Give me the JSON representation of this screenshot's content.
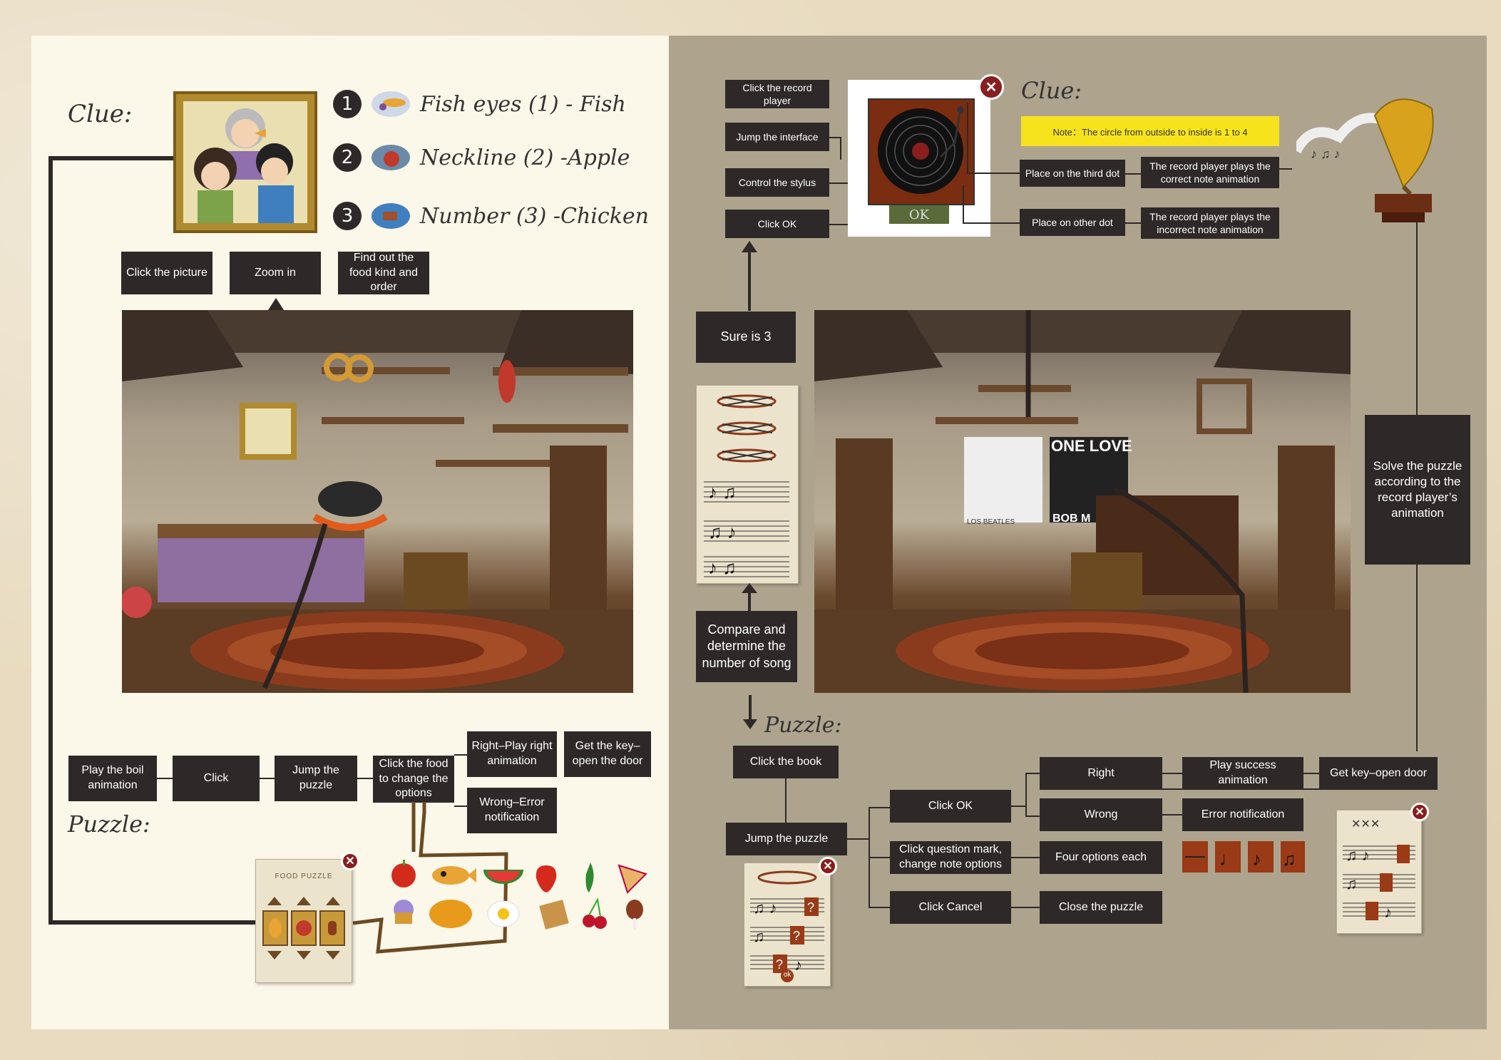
{
  "left": {
    "clue_heading": "Clue:",
    "clue_items": [
      {
        "num": "1",
        "text": "Fish eyes (1) - Fish"
      },
      {
        "num": "2",
        "text": "Neckline (2) -Apple"
      },
      {
        "num": "3",
        "text": "Number (3) -Chicken"
      }
    ],
    "top_flow": [
      "Click the picture",
      "Zoom in",
      "Find out the food kind and order"
    ],
    "bottom_flow": {
      "play_boil": "Play the boil animation",
      "click": "Click",
      "jump_puzzle": "Jump the puzzle",
      "click_food": "Click the food to change the options",
      "right": "Right–Play right animation",
      "get_key": "Get the key–open the door",
      "wrong": "Wrong–Error notification"
    },
    "puzzle_heading": "Puzzle:",
    "puzzle_card_title": "FOOD PUZZLE",
    "food_icons": [
      "apple-icon",
      "fish-icon",
      "watermelon-icon",
      "strawberry-icon",
      "pepper-icon",
      "pizza-icon",
      "muffin-icon",
      "pumpkin-icon",
      "egg-icon",
      "bread-icon",
      "cherry-icon",
      "drumstick-icon"
    ]
  },
  "right": {
    "top_flow": [
      "Click the record player",
      "Jump the interface",
      "Control the stylus",
      "Click OK"
    ],
    "ok_label": "OK",
    "clue_heading": "Clue:",
    "note": "Note：The circle from outside to inside is 1 to 4",
    "dot_actions": [
      "Place on the third dot",
      "Place on other dot"
    ],
    "dot_results": [
      "The record player plays the correct note animation",
      "The record player plays the incorrect note animation"
    ],
    "sure": "Sure is 3",
    "compare": "Compare and determine the number of song",
    "solve": "Solve the puzzle according to the record player’s animation",
    "puzzle_heading": "Puzzle:",
    "poster_text": [
      "ONE LOVE",
      "BOB M",
      "LOS BEATLES"
    ],
    "bottom_flow": {
      "click_book": "Click the book",
      "jump_puzzle": "Jump the puzzle",
      "click_ok": "Click OK",
      "click_q": "Click question mark, change note options",
      "click_cancel": "Click Cancel",
      "right": "Right",
      "wrong": "Wrong",
      "four_options": "Four options each",
      "close": "Close the puzzle",
      "play_success": "Play success animation",
      "error": "Error notification",
      "get_key": "Get key–open door"
    },
    "music_sheet_ok": "ok"
  },
  "colors": {
    "box": "#2e2928",
    "left_bg": "#fbf7e9",
    "right_bg": "#aea48e",
    "note_yellow": "#f7e31c",
    "ok_green": "#5a6b3a",
    "close_red": "#8a1d1d"
  }
}
